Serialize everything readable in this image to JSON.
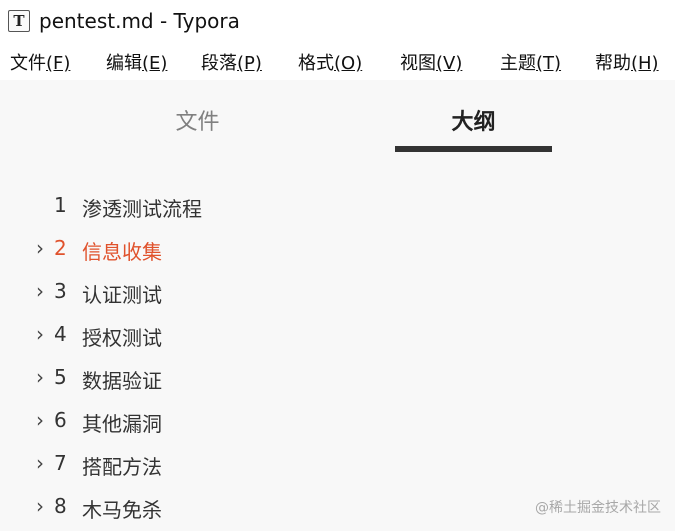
{
  "window": {
    "app_icon_letter": "T",
    "title": "pentest.md - Typora"
  },
  "menubar": {
    "items": [
      {
        "label": "文件",
        "accel": "(F)"
      },
      {
        "label": "编辑",
        "accel": "(E)"
      },
      {
        "label": "段落",
        "accel": "(P)"
      },
      {
        "label": "格式",
        "accel": "(O)"
      },
      {
        "label": "视图",
        "accel": "(V)"
      },
      {
        "label": "主题",
        "accel": "(T)"
      },
      {
        "label": "帮助",
        "accel": "(H)"
      }
    ]
  },
  "sidebar": {
    "tabs": {
      "files": "文件",
      "outline": "大纲"
    },
    "outline": [
      {
        "chevron": "",
        "num": "1",
        "label": "渗透测试流程"
      },
      {
        "chevron": "›",
        "num": "2",
        "label": "信息收集"
      },
      {
        "chevron": "›",
        "num": "3",
        "label": "认证测试"
      },
      {
        "chevron": "›",
        "num": "4",
        "label": "授权测试"
      },
      {
        "chevron": "›",
        "num": "5",
        "label": "数据验证"
      },
      {
        "chevron": "›",
        "num": "6",
        "label": "其他漏洞"
      },
      {
        "chevron": "›",
        "num": "7",
        "label": "搭配方法"
      },
      {
        "chevron": "›",
        "num": "8",
        "label": "木马免杀"
      }
    ],
    "active_index": 1
  },
  "colors": {
    "active": "#e0522c",
    "text": "#333333",
    "muted": "#808080",
    "sidebar_bg": "#f8f8f8"
  },
  "watermark": "@稀土掘金技术社区"
}
